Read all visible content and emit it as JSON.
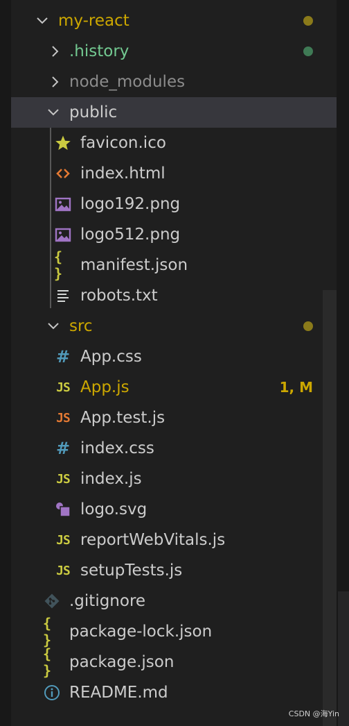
{
  "explorer": {
    "root": {
      "label": "my-react",
      "status_color": "#8a7a1a"
    },
    "items": [
      {
        "label": ".history",
        "kind": "folder",
        "status": "untracked",
        "status_color": "#3f7a55"
      },
      {
        "label": "node_modules",
        "kind": "folder",
        "status": "ignored"
      },
      {
        "label": "public",
        "kind": "folder-open",
        "status": "normal"
      },
      {
        "label": "favicon.ico",
        "kind": "file",
        "icon": "star-icon"
      },
      {
        "label": "index.html",
        "kind": "file",
        "icon": "html-icon"
      },
      {
        "label": "logo192.png",
        "kind": "file",
        "icon": "image-icon"
      },
      {
        "label": "logo512.png",
        "kind": "file",
        "icon": "image-icon"
      },
      {
        "label": "manifest.json",
        "kind": "file",
        "icon": "json-icon"
      },
      {
        "label": "robots.txt",
        "kind": "file",
        "icon": "text-lines-icon"
      },
      {
        "label": "src",
        "kind": "folder-open",
        "status": "modified",
        "status_color": "#8a7a1a"
      },
      {
        "label": "App.css",
        "kind": "file",
        "icon": "css-icon"
      },
      {
        "label": "App.js",
        "kind": "file",
        "icon": "js-icon",
        "status": "modified",
        "badge": "1, M"
      },
      {
        "label": "App.test.js",
        "kind": "file",
        "icon": "js-test-icon"
      },
      {
        "label": "index.css",
        "kind": "file",
        "icon": "css-icon"
      },
      {
        "label": "index.js",
        "kind": "file",
        "icon": "js-icon"
      },
      {
        "label": "logo.svg",
        "kind": "file",
        "icon": "svg-icon"
      },
      {
        "label": "reportWebVitals.js",
        "kind": "file",
        "icon": "js-icon"
      },
      {
        "label": "setupTests.js",
        "kind": "file",
        "icon": "js-icon"
      },
      {
        "label": ".gitignore",
        "kind": "file",
        "icon": "git-icon"
      },
      {
        "label": "package-lock.json",
        "kind": "file",
        "icon": "json-icon"
      },
      {
        "label": "package.json",
        "kind": "file",
        "icon": "json-icon"
      },
      {
        "label": "README.md",
        "kind": "file",
        "icon": "info-icon"
      }
    ],
    "icon_text": {
      "js": "JS",
      "css": "#",
      "json": "{ }"
    }
  },
  "colors": {
    "modified": "#cca700",
    "untracked": "#73c991",
    "ignored": "#8c8c8c",
    "js": "#cbcb41",
    "js_test": "#e37933",
    "css": "#519aba",
    "html": "#e37933",
    "image": "#a074c4",
    "selection": "#37373d"
  },
  "watermark": "CSDN @海Yin"
}
